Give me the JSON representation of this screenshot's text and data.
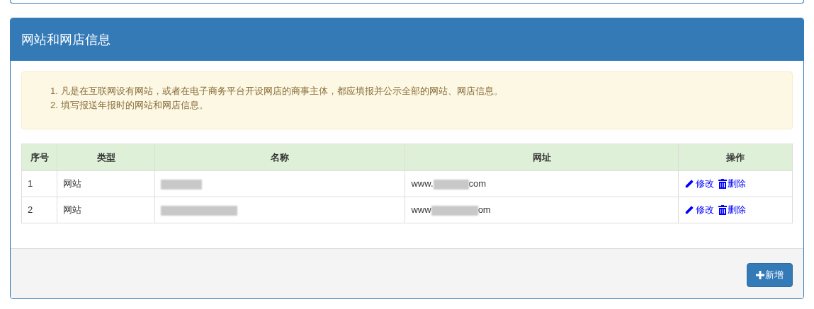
{
  "panel": {
    "title": "网站和网店信息"
  },
  "notice": [
    {
      "number": "1.",
      "text": "凡是在互联网设有网站，或者在电子商务平台开设网店的商事主体，都应填报并公示全部的网站、网店信息。"
    },
    {
      "number": "2.",
      "text": "填写报送年报时的网站和网店信息。"
    }
  ],
  "table": {
    "columns": [
      "序号",
      "类型",
      "名称",
      "网址",
      "操作"
    ],
    "rows": [
      {
        "index": "1",
        "type": "网站",
        "url_start": "www.",
        "url_end": "com",
        "actions": [
          {
            "kind": "edit",
            "label": "修改"
          },
          {
            "kind": "delete",
            "label": "删除"
          }
        ]
      },
      {
        "index": "2",
        "type": "网站",
        "url_start": "www",
        "url_end": "om",
        "actions": [
          {
            "kind": "edit",
            "label": "修改"
          },
          {
            "kind": "delete",
            "label": "删除"
          }
        ]
      }
    ]
  },
  "footer": {
    "add_button": "新增"
  }
}
